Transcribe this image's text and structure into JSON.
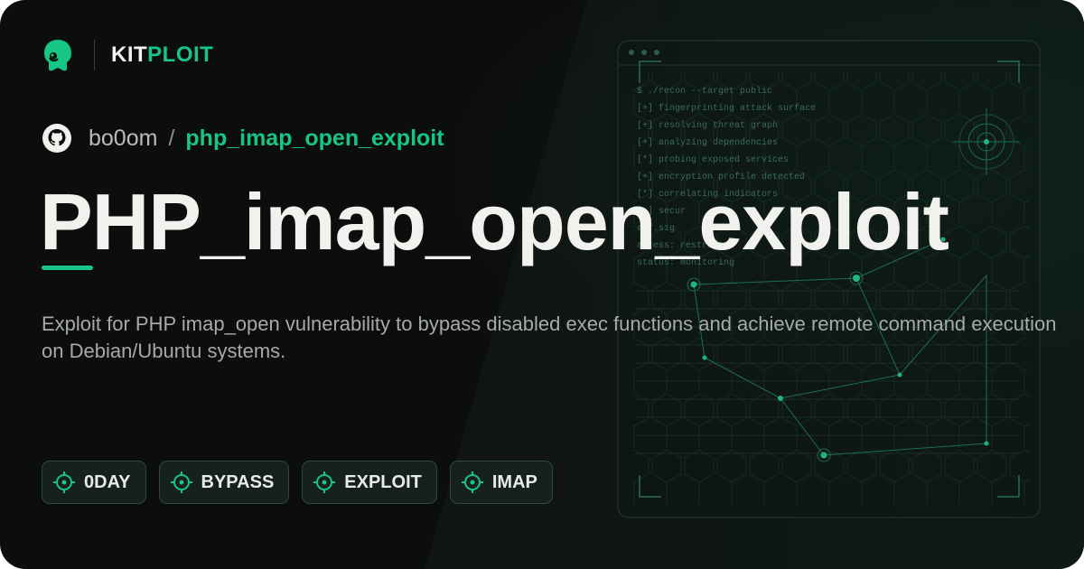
{
  "brand": {
    "part1": "KIT",
    "part2": "PLOIT"
  },
  "repo": {
    "owner": "bo0om",
    "separator": "/",
    "name": "php_imap_open_exploit"
  },
  "title": "PHP_imap_open_exploit",
  "description": "Exploit for PHP imap_open vulnerability to bypass disabled exec functions and achieve remote command execution on Debian/Ubuntu systems.",
  "tags": [
    "0DAY",
    "BYPASS",
    "EXPLOIT",
    "IMAP"
  ],
  "terminal_lines": [
    "$ ./recon --target public",
    "[+] fingerprinting attack surface",
    "[+] resolving threat graph",
    "[+] analyzing dependencies",
    "[*] probing exposed services",
    "[+] encryption profile detected",
    "[*] correlating indicators",
    "[+] secur",
    "a7f.sig",
    "access: restricted",
    "status: monitoring"
  ],
  "colors": {
    "accent": "#17c684",
    "background": "#0c0d0d",
    "text": "#f1f1ee",
    "muted": "#a6aaa8"
  },
  "icons": {
    "logo": "kitploit-mascot-icon",
    "repo": "github-icon",
    "tag": "crosshair-icon"
  }
}
